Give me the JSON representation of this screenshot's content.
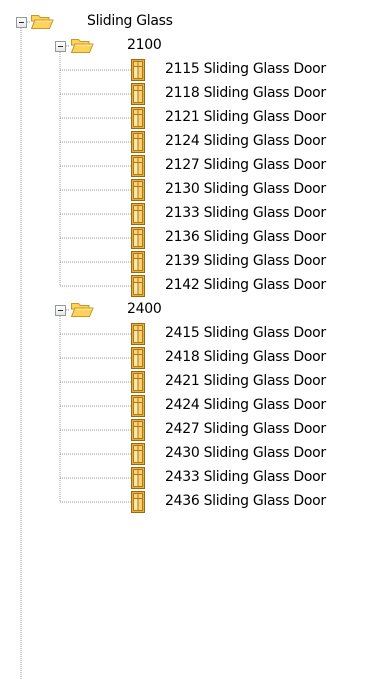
{
  "tree": {
    "root": {
      "label": "Sliding Glass",
      "icon": "folder-open-icon",
      "expanded": true,
      "children": [
        {
          "label": "2100",
          "icon": "folder-open-icon",
          "expanded": true,
          "items": [
            "2115 Sliding Glass Door",
            "2118 Sliding Glass Door",
            "2121 Sliding Glass Door",
            "2124 Sliding Glass Door",
            "2127 Sliding Glass Door",
            "2130 Sliding Glass Door",
            "2133 Sliding Glass Door",
            "2136 Sliding Glass Door",
            "2139 Sliding Glass Door",
            "2142 Sliding Glass Door"
          ]
        },
        {
          "label": "2400",
          "icon": "folder-open-icon",
          "expanded": true,
          "items": [
            "2415 Sliding Glass Door",
            "2418 Sliding Glass Door",
            "2421 Sliding Glass Door",
            "2424 Sliding Glass Door",
            "2427 Sliding Glass Door",
            "2430 Sliding Glass Door",
            "2433 Sliding Glass Door",
            "2436 Sliding Glass Door"
          ]
        }
      ]
    }
  },
  "colors": {
    "folder_fill": "#ffd35a",
    "folder_stroke": "#c9962a",
    "door_fill": "#e8b23a",
    "door_stroke": "#9a6a10",
    "tree_line": "#9a9a9a"
  }
}
